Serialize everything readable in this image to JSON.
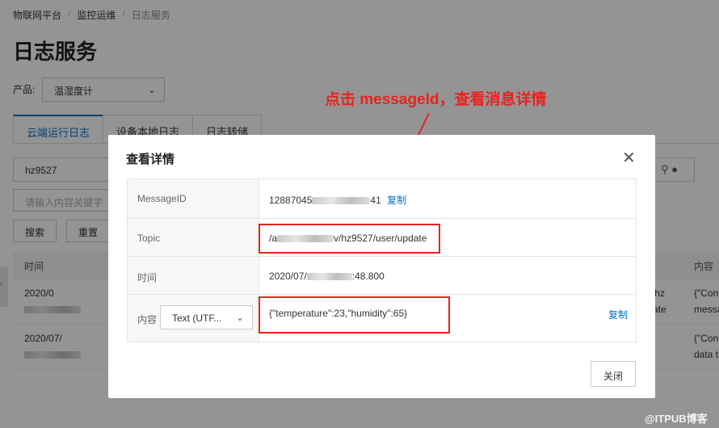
{
  "breadcrumb": [
    "物联网平台",
    "监控运维",
    "日志服务"
  ],
  "breadcrumb_sep": "/",
  "page": {
    "title": "日志服务",
    "product_label": "产品:",
    "product_value": "温湿度计",
    "tabs": [
      "云端运行日志",
      "设备本地日志",
      "日志转储"
    ],
    "device_value": "hz9527",
    "keyword_placeholder": "请输入内容关键字",
    "search_label": "搜索",
    "reset_label": "重置",
    "col_time": "时间",
    "col_content": "内容",
    "rows": [
      {
        "time": "2020/0",
        "r1": "'hz",
        "r2": "ate",
        "r3": "{\"Con",
        "r4": "messa"
      },
      {
        "time": "2020/07/",
        "r1": "",
        "r2": "",
        "r3": "{\"Con",
        "r4": "data t"
      }
    ]
  },
  "annotation": "点击 messageId，查看消息详情",
  "modal": {
    "title": "查看详情",
    "close_icon": "close-icon",
    "rows": {
      "message_id_label": "MessageID",
      "message_id_prefix": "12887045",
      "message_id_suffix": "41",
      "copy_label": "复制",
      "topic_label": "Topic",
      "topic_prefix": "/a",
      "topic_suffix": "v/hz9527/user/update",
      "time_label": "时间",
      "time_prefix": "2020/07/",
      "time_suffix": ":48.800",
      "content_label": "内容",
      "format_value": "Text (UTF...",
      "content_value": "{\"temperature\":23,\"humidity\":65}"
    },
    "close_button": "关闭"
  },
  "watermark": "@ITPUB博客",
  "colors": {
    "accent": "#0070cc",
    "annotation": "#e8231e"
  }
}
